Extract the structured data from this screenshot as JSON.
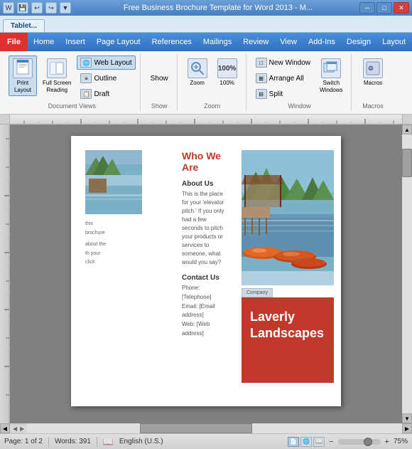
{
  "titleBar": {
    "text": "Free Business Brochure Template for Word 2013 - M...",
    "icons": [
      "💾",
      "↩",
      "↪",
      "▼"
    ],
    "closeBtn": "✕",
    "minBtn": "─",
    "maxBtn": "□"
  },
  "tabs": [
    {
      "label": "Tablet...",
      "active": true
    }
  ],
  "menuBar": {
    "file": "File",
    "items": [
      "Home",
      "Insert",
      "Page Layout",
      "References",
      "Mailings",
      "Review",
      "View",
      "Add-Ins",
      "Design",
      "Layout"
    ]
  },
  "ribbon": {
    "groups": [
      {
        "label": "Document Views",
        "buttons": [
          {
            "id": "print-layout",
            "label": "Print\nLayout",
            "icon": "📄",
            "active": true,
            "large": true
          },
          {
            "id": "full-screen",
            "label": "Full Screen\nReading",
            "icon": "⬜",
            "active": false,
            "large": true
          }
        ],
        "smallButtons": [
          {
            "id": "web-layout",
            "label": "Web Layout",
            "active": false
          },
          {
            "id": "outline",
            "label": "Outline",
            "active": false
          },
          {
            "id": "draft",
            "label": "Draft",
            "active": false
          }
        ]
      },
      {
        "label": "Show",
        "smallButtons": [
          {
            "id": "show-btn",
            "label": "Show",
            "active": false
          }
        ]
      },
      {
        "label": "Zoom",
        "buttons": [
          {
            "id": "zoom-btn",
            "label": "Zoom",
            "icon": "🔍",
            "large": true
          }
        ],
        "zoomValue": "100%"
      },
      {
        "label": "Window",
        "buttons": [
          {
            "id": "new-window",
            "label": "New Window",
            "active": false
          },
          {
            "id": "arrange-all",
            "label": "Arrange All",
            "active": false
          },
          {
            "id": "split",
            "label": "Split",
            "active": false
          },
          {
            "id": "switch-windows",
            "label": "Switch\nWindows",
            "icon": "⊞",
            "large": true
          }
        ]
      },
      {
        "label": "Macros",
        "buttons": [
          {
            "id": "macros-btn",
            "label": "Macros",
            "icon": "⚙",
            "large": true
          }
        ]
      }
    ]
  },
  "document": {
    "page": {
      "whoWeAre": "Who We Are",
      "aboutHead": "About Us",
      "aboutText": "This is the place for your 'elevator pitch.' If you only had a few seconds to pitch your products or services to someone, what would you say?",
      "contactHead": "Contact Us",
      "contactPhone": "Phone: [Telephone]",
      "contactEmail": "Email: [Email address]",
      "contactWeb": "Web: [Web address]",
      "leftSnippets": [
        "this",
        "brochure",
        "about the",
        "th your",
        "click"
      ]
    },
    "brochure": {
      "companyTab": "Company",
      "companyName": "Laverly\nLandscapes"
    }
  },
  "statusBar": {
    "page": "Page: 1 of 2",
    "words": "Words: 391",
    "language": "English (U.S.)",
    "zoom": "75%"
  }
}
